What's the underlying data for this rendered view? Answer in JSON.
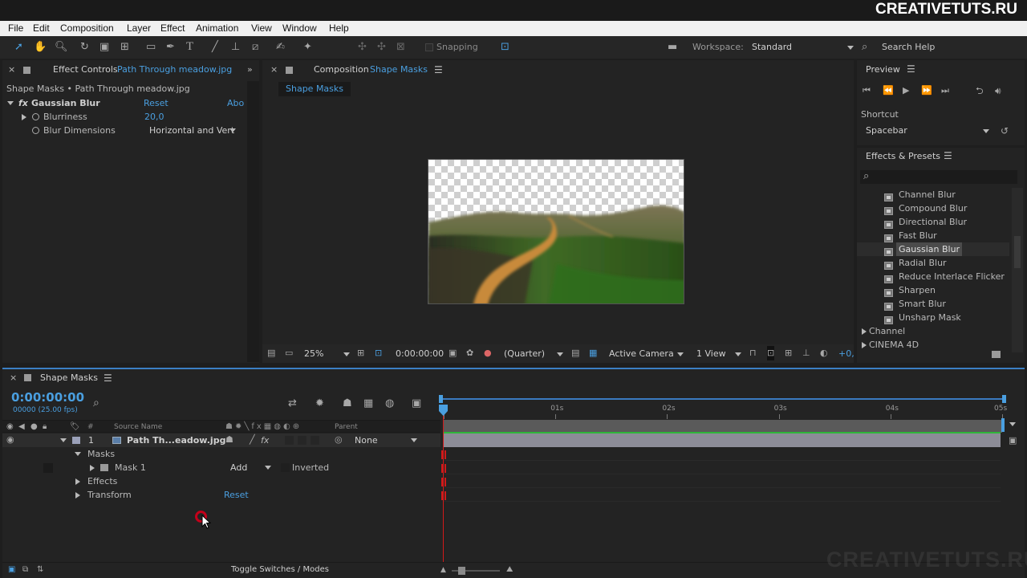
{
  "watermark_top": "CREATIVETUTS.RU",
  "watermark_bottom": "CREATIVETUTS.RU",
  "menu": [
    "File",
    "Edit",
    "Composition",
    "Layer",
    "Effect",
    "Animation",
    "View",
    "Window",
    "Help"
  ],
  "toolbar": {
    "snapping_label": "Snapping",
    "workspace_label": "Workspace:",
    "workspace_value": "Standard",
    "search_help": "Search Help"
  },
  "effect_controls": {
    "tab_label": "Effect Controls",
    "tab_file": "Path Through meadow.jpg",
    "breadcrumb": "Shape Masks • Path Through meadow.jpg",
    "effect_name": "Gaussian Blur",
    "reset": "Reset",
    "about": "Abo",
    "blurriness_label": "Blurriness",
    "blurriness_value": "20,0",
    "blur_dimensions_label": "Blur Dimensions",
    "blur_dimensions_value": "Horizontal and Vert"
  },
  "composition": {
    "tab_label": "Composition",
    "tab_name": "Shape Masks",
    "comp_tab": "Shape Masks",
    "zoom": "25%",
    "timecode": "0:00:00:00",
    "resolution": "(Quarter)",
    "camera": "Active Camera",
    "views": "1 View",
    "exposure": "+0,"
  },
  "preview": {
    "title": "Preview",
    "shortcut_label": "Shortcut",
    "shortcut_value": "Spacebar"
  },
  "effects_presets": {
    "title": "Effects & Presets",
    "search_glyph": "⌕",
    "items": [
      "Channel Blur",
      "Compound Blur",
      "Directional Blur",
      "Fast Blur",
      "Gaussian Blur",
      "Radial Blur",
      "Reduce Interlace Flicker",
      "Sharpen",
      "Smart Blur",
      "Unsharp Mask"
    ],
    "selected": "Gaussian Blur",
    "categories": [
      "Channel",
      "CINEMA 4D"
    ]
  },
  "timeline": {
    "tab_label": "Shape Masks",
    "timecode": "0:00:00:00",
    "fps": "00000 (25.00 fps)",
    "col_hash": "#",
    "col_source": "Source Name",
    "col_parent": "Parent",
    "layer_number": "1",
    "layer_name": "Path Th...eadow.jpg",
    "parent_value": "None",
    "masks": "Masks",
    "mask1": "Mask 1",
    "mask_mode": "Add",
    "inverted": "Inverted",
    "effects": "Effects",
    "transform": "Transform",
    "transform_reset": "Reset",
    "ruler": [
      "0s",
      "01s",
      "02s",
      "03s",
      "04s",
      "05s"
    ],
    "toggle_label": "Toggle Switches / Modes"
  },
  "colors": {
    "accent": "#4a9fe0",
    "layer_bar": "#8c8c97",
    "green_bar": "#2fb53a",
    "playhead": "#d11a1a"
  }
}
